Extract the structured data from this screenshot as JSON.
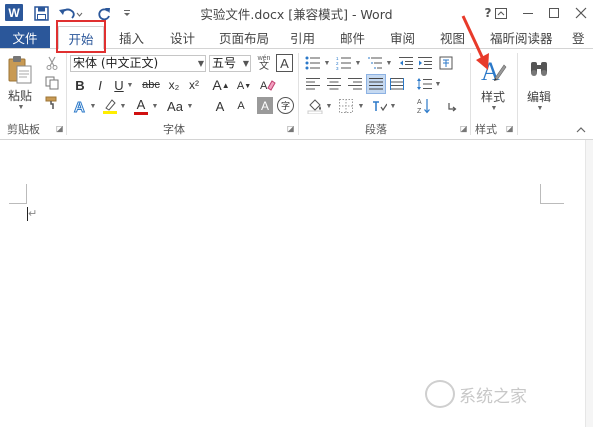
{
  "window": {
    "title": "实验文件.docx [兼容模式] - Word",
    "app_logo_text": "W",
    "help_label": "?"
  },
  "tabs": {
    "file": "文件",
    "items": [
      "开始",
      "插入",
      "设计",
      "页面布局",
      "引用",
      "邮件",
      "审阅",
      "视图",
      "福昕阅读器",
      "登"
    ]
  },
  "ribbon": {
    "clipboard": {
      "paste_label": "粘贴",
      "group_label": "剪贴板"
    },
    "font": {
      "font_name": "宋体 (中文正文)",
      "font_size": "五号",
      "group_label": "字体",
      "bold": "B",
      "italic": "I",
      "underline": "U",
      "strike": "abc",
      "subscript": "x₂",
      "superscript": "x²",
      "font_color": "A",
      "change_case": "Aa",
      "grow": "A",
      "shrink": "A",
      "phonetic": "wén",
      "border_char": "A",
      "shade_char": "A",
      "enclose_char": "字"
    },
    "paragraph": {
      "group_label": "段落"
    },
    "styles": {
      "label": "样式",
      "group_label": "样式"
    },
    "editing": {
      "label": "编辑"
    }
  },
  "watermark": {
    "text": "系统之家"
  },
  "colors": {
    "brand": "#2b579a",
    "highlight_box": "#e03030",
    "font_color_bar": "#d01010",
    "highlight_bar": "#ffee00"
  }
}
